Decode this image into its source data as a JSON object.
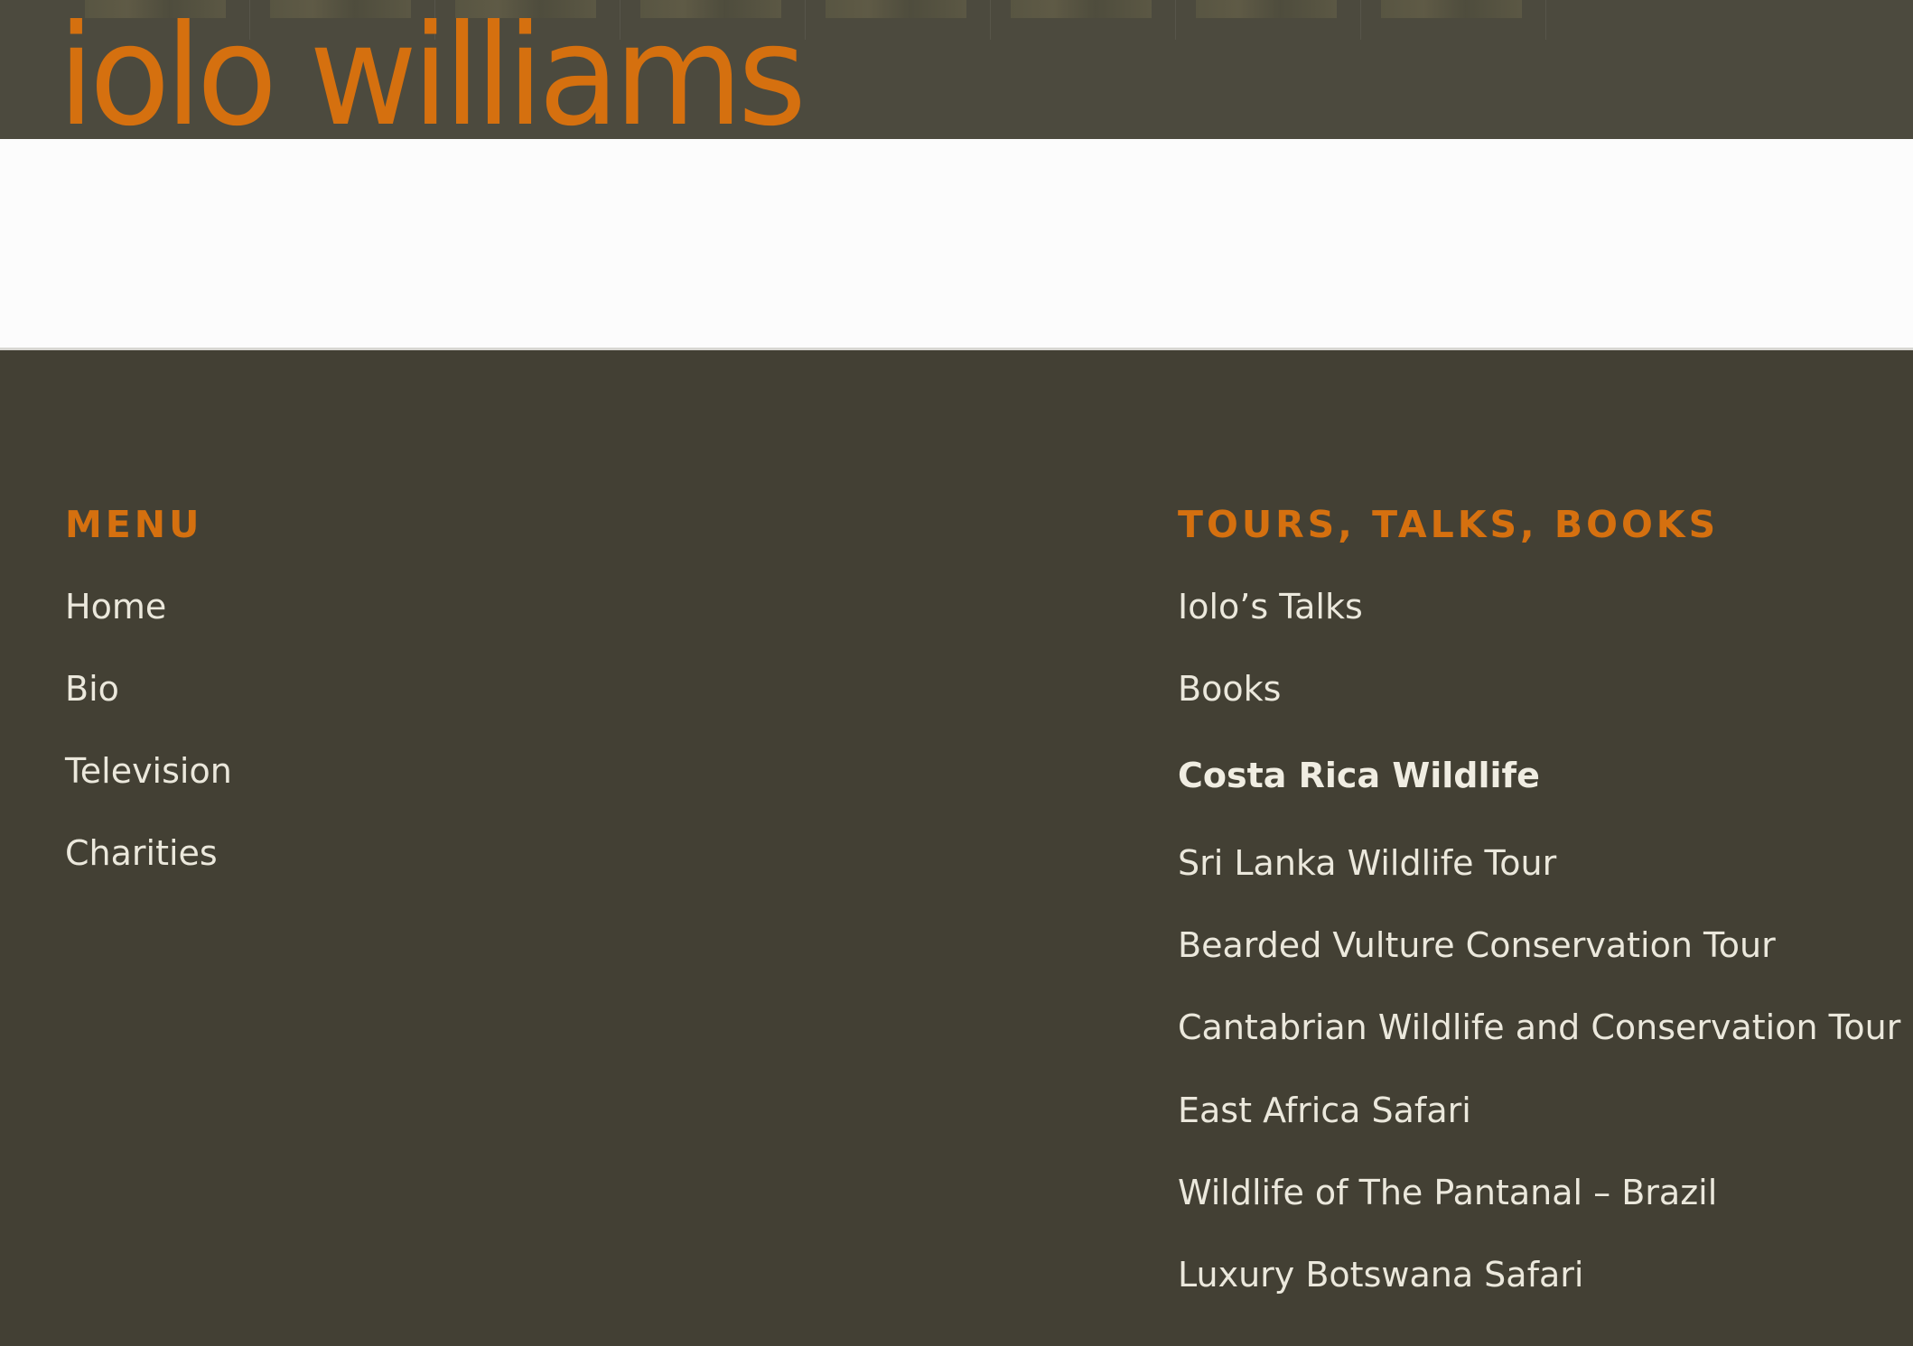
{
  "header": {
    "logo_text": "iolo williams",
    "thumbnails": [
      "thumbnail",
      "thumbnail",
      "thumbnail",
      "thumbnail",
      "thumbnail",
      "thumbnail",
      "thumbnail",
      "thumbnail"
    ]
  },
  "footer": {
    "menu": {
      "title": "MENU",
      "items": [
        {
          "label": "Home"
        },
        {
          "label": "Bio"
        },
        {
          "label": "Television"
        },
        {
          "label": "Charities"
        }
      ]
    },
    "tours": {
      "title": "TOURS, TALKS, BOOKS",
      "items": [
        {
          "label": "Iolo’s Talks"
        },
        {
          "label": "Books"
        },
        {
          "label": "Costa Rica Wildlife",
          "current": true
        },
        {
          "label": "Sri Lanka Wildlife Tour"
        },
        {
          "label": "Bearded Vulture Conservation Tour"
        },
        {
          "label": "Cantabrian Wildlife and Conservation Tour"
        },
        {
          "label": "East Africa Safari"
        },
        {
          "label": "Wildlife of The Pantanal – Brazil"
        },
        {
          "label": "Luxury Botswana Safari"
        }
      ]
    }
  },
  "colors": {
    "accent": "#d5700f",
    "footer_bg": "#434034",
    "header_bg": "#4c4a3e",
    "link_text": "#ebe8dc"
  }
}
